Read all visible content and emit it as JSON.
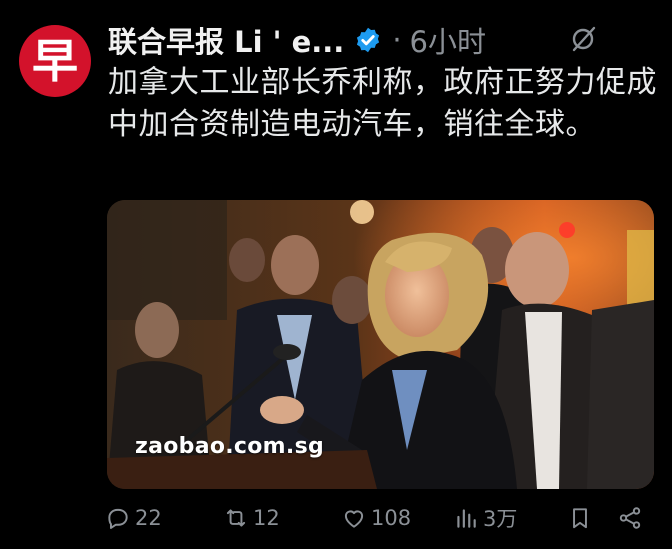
{
  "avatar": {
    "glyph": "早",
    "color": "#d3122b"
  },
  "header": {
    "display_name": "联合早报 Li  ' e...",
    "separator": "·",
    "timestamp": "6小时"
  },
  "tweet": {
    "text": "加拿大工业部长乔利称，政府正努力促成中加合资制造电动汽车，销往全球。"
  },
  "media": {
    "watermark": "zaobao.com.sg"
  },
  "actions": {
    "reply_count": "22",
    "retweet_count": "12",
    "like_count": "108",
    "views_count": "3万"
  },
  "icons": {
    "verified": "verified-badge-icon",
    "grok": "grok-icon",
    "reply": "reply-icon",
    "retweet": "retweet-icon",
    "like": "heart-icon",
    "views": "views-chart-icon",
    "bookmark": "bookmark-icon",
    "share": "share-icon"
  },
  "colors": {
    "background": "#000000",
    "text": "#e7e9ea",
    "muted": "#8b9096",
    "verified": "#1d9bf0"
  }
}
